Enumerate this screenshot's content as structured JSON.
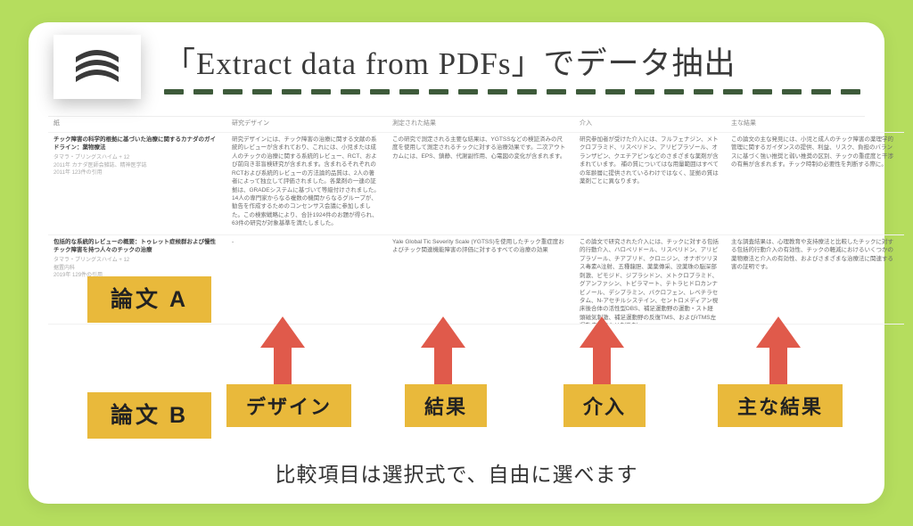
{
  "title": "「Extract data from PDFs」でデータ抽出",
  "logo_name": "book-stack-icon",
  "table": {
    "headers": [
      "紙",
      "研究デザイン",
      "測定された結果",
      "介入",
      "主な結果"
    ],
    "rows": [
      {
        "title": "チック障害の科学的根拠に基づいた治療に関するカナダのガイドライン：薬物療法",
        "author": "タマラ・プリングスハイム +  12",
        "meta": "2011年  123件の引用",
        "sub": "2011年 カナダ医師会雑誌、精神医学誌",
        "cells": [
          "研究デザインには、チック障害の治療に関する文献の系統的レビューが含まれており、これには、小児または成人のチックの治療に関する系統的レビュー、RCT、および前向き非盲検研究が含まれます。含まれるそれぞれのRCTおよび系統的レビューの方法論的品質は、2人の著者によって独立して評価されました。各薬剤の一連の証拠は、GRADEシステムに基づいて等級付けされました。14人の専門家からなる複数の機関からなるグループが、勧告を作成するためのコンセンサス会議に参加しました。この検索戦略により、合計1924件のお題が得られ、63件の研究が対象基準を満たしました。",
          "この研究で測定される主要な結果は、YGTSSなどの検証済みの尺度を使用して測定されるチックに対する治療効果です。二次アウトカムには、EPS、鎮静、代謝副作用、心電図の変化が含まれます。",
          "研究参加者が受けた介入には、フルフェナジン、メトクロプラミド、リスペリドン、アリピプラゾール、オランザピン、クエチアピンなどのさまざまな薬剤が含まれています。       補の質についてはな用量範囲はすべての年齢層に提供されているわけではなく、証拠の質は薬剤ごとに異なります。",
          "この論文の主な発見には、小児と成人のチック障害の薬理学的管理に関するガイダンスの提供、利益、リスク、負担のバランスに基づく強い推奨と弱い推奨の区別、チックの重症度と干渉の有無が含まれます。チック時制の必要性を判断する際に。"
        ]
      },
      {
        "title": "包括的な系統的レビューの概要：トゥレット症候群および慢性チック障害を持つ人々のチックの治療",
        "author": "タマラ・プリングスハイム +  12",
        "meta": "2019年  129件の引用",
        "sub": "据置内科",
        "cells": [
          "-",
          "Yale Global Tic Severity Scale (YGTSS)を使用したチック重症度およびチック関連機能障害の評価に対するすべての治療の効果",
          "この論文で研究された介入には、チックに対する包括的行動介入、ハロペリドール、リスペリドン、アリピプラゾール、チアプリド、クロニジン、オナボツリヌス毒素A注射、五種龍胆、薬薬傳采、没薬珠の脳深部刺激、ピモジド、ジプラシドン、メトクロプラミド、グアンファシン、トピラマート、テトラヒドロカンナビノール、デシプラミン、バクロフェン、レベチラセタム、N-アセチルシステイン、セントロメディアン視床後合体の活性型DBS、補足運動野の運動・スト経頭磁気刺激、補足運動野の反復TMS、およびrTMS左運動皮質または刺激刺。",
          "主な調査結果は、心理教育や支持療法と比較したチックに対する包括的行動介入の有効性、チックの軽減におけるいくつかの薬物療法と介入の有効性、およびさまざまな治療法に関連する害の証明です。"
        ]
      }
    ]
  },
  "badges": {
    "a": "論文 A",
    "b": "論文 B"
  },
  "chips": {
    "design": "デザイン",
    "result": "結果",
    "intervention": "介入",
    "main": "主な結果"
  },
  "caption": "比較項目は選択式で、自由に選べます"
}
